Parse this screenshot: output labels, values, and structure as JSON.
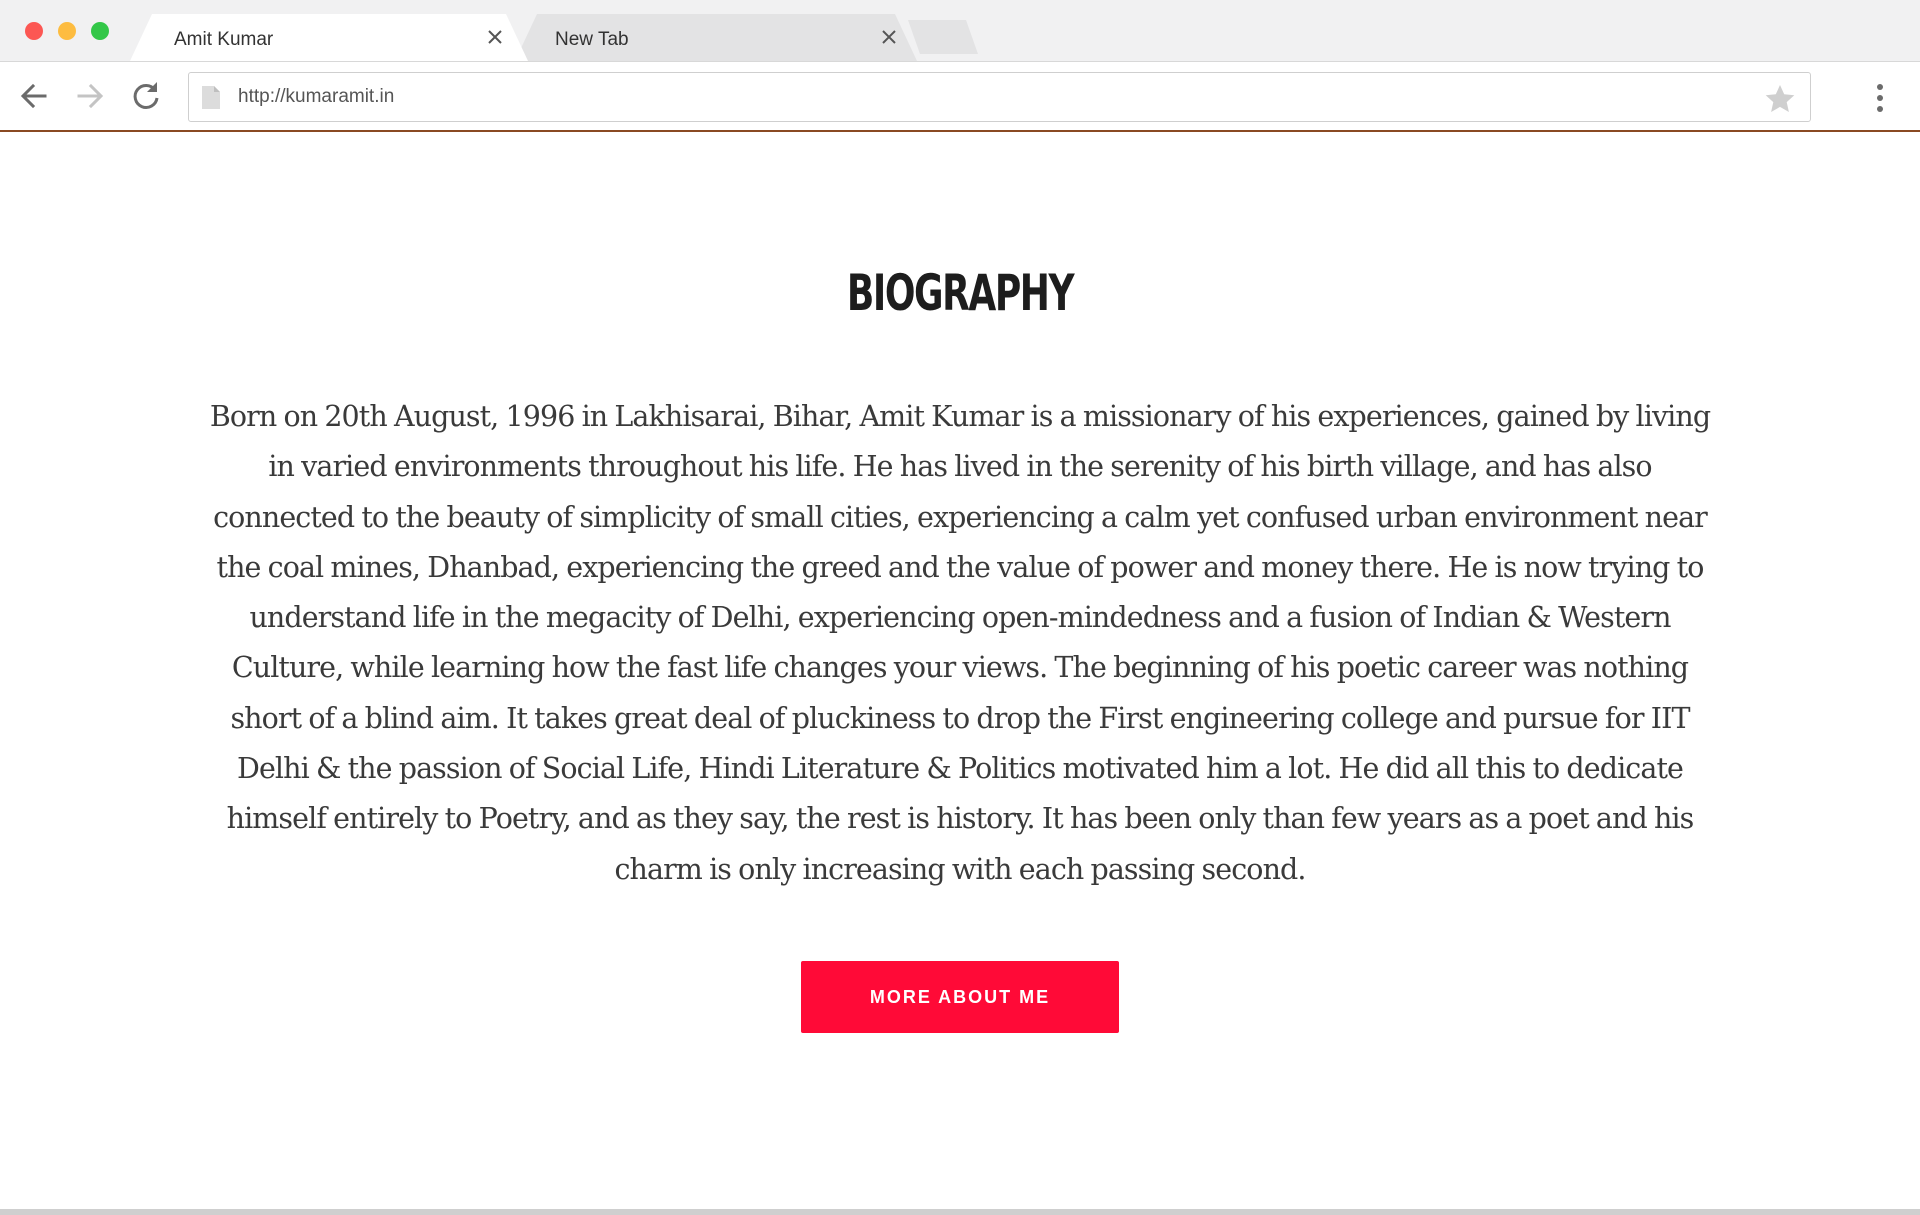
{
  "browser": {
    "tabs": [
      {
        "title": "Amit Kumar",
        "active": true
      },
      {
        "title": "New Tab",
        "active": false
      }
    ],
    "address_bar": {
      "url": "http://kumaramit.in"
    },
    "icons": {
      "back": "arrow-left-icon",
      "forward": "arrow-right-icon",
      "reload": "reload-icon",
      "page": "page-icon",
      "bookmark": "star-icon",
      "menu": "more-vert-icon",
      "tab_close": "close-icon"
    },
    "colors": {
      "traffic_red": "#fc5753",
      "traffic_yellow": "#fdbc40",
      "traffic_green": "#33c748"
    }
  },
  "biography": {
    "heading": "BIOGRAPHY",
    "text": "Born on 20th August, 1996 in Lakhisarai, Bihar, Amit Kumar is a missionary of his experiences, gained by living in varied environments throughout his life. He has lived in the serenity of his birth village, and has also connected to the beauty of simplicity of small cities, experiencing a calm yet confused urban environment near the coal mines, Dhanbad, experiencing the greed and the value of power and money there. He is now trying to understand life in the megacity of Delhi, experiencing open-mindedness and a fusion of Indian & Western Culture, while learning how the fast life changes your views. The beginning of his poetic career was nothing short of a blind aim. It takes great deal of pluckiness to drop the First engineering college and pursue for IIT Delhi & the passion of Social Life, Hindi Literature & Politics motivated him a lot. He did all this to dedicate himself entirely to Poetry, and as they say, the rest is history. It has been only than few years as a poet and his charm is only increasing with each passing second.",
    "button_label": "MORE ABOUT ME",
    "button_color": "#ff0a37",
    "accent_line_color": "#8a4a23"
  }
}
